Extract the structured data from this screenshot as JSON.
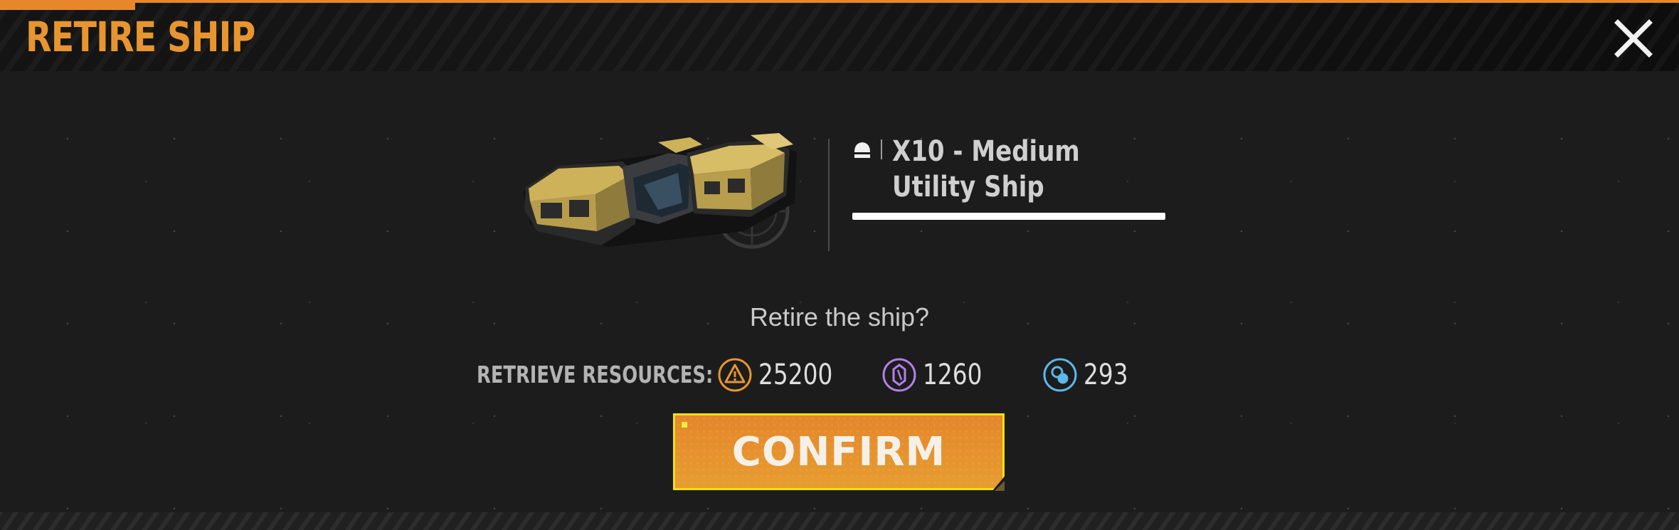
{
  "dialog": {
    "title": "RETIRE SHIP"
  },
  "ship": {
    "name": "X10 - Medium Utility Ship",
    "class_icon": "ship-class-icon"
  },
  "question": "Retire the ship?",
  "resources": {
    "label": "RETRIEVE RESOURCES:",
    "items": [
      {
        "icon": "warning-triangle-resource-icon",
        "value": "25200",
        "color": "#e8952f"
      },
      {
        "icon": "crystal-resource-icon",
        "value": "1260",
        "color": "#b57ee8"
      },
      {
        "icon": "orb-resource-icon",
        "value": "293",
        "color": "#5cb8e8"
      }
    ]
  },
  "confirm": {
    "label": "CONFIRM"
  },
  "colors": {
    "accent": "#e8952f",
    "button_border": "#f1e10a"
  }
}
